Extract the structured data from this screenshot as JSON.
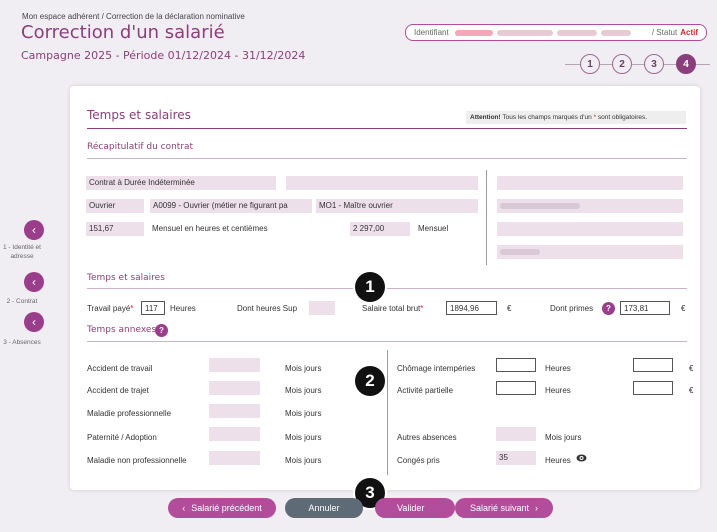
{
  "header": {
    "breadcrumb": "Mon espace adhérent / Correction de la déclaration nominative",
    "title": "Correction d'un salarié",
    "campaign": "Campagne 2025 - Période 01/12/2024 - 31/12/2024",
    "identifiant_label": "Identifiant",
    "status_label": "/ Statut",
    "status_value": "Actif"
  },
  "steps": [
    "1",
    "2",
    "3",
    "4"
  ],
  "active_step": 4,
  "sidebar": {
    "items": [
      {
        "label": "1 - Identité et adresse"
      },
      {
        "label": "2 - Contrat"
      },
      {
        "label": "3 - Absences"
      }
    ]
  },
  "section": {
    "title": "Temps et salaires",
    "attention_bold": "Attention!",
    "attention_text": " Tous les champs marqués d'un ",
    "attention_star": "*",
    "attention_end": " sont obligatoires."
  },
  "contract": {
    "title": "Récapitulatif du contrat",
    "type": "Contrat à Durée Indéterminée",
    "category": "Ouvrier",
    "job": "A0099 - Ouvrier (métier ne figurant pa",
    "level": "MO1 - Maître ouvrier",
    "hours": "151,67",
    "hours_label": "Mensuel en heures et centièmes",
    "salary": "2 297,00",
    "salary_label": "Mensuel"
  },
  "salaries": {
    "title": "Temps et salaires",
    "worked_label": "Travail payé",
    "worked_value": "117",
    "worked_unit": "Heures",
    "overtime_label": "Dont heures Sup",
    "gross_label": "Salaire total brut",
    "gross_value": "1894,96",
    "gross_unit": "€",
    "bonus_label": "Dont primes",
    "bonus_value": "173,81",
    "bonus_unit": "€",
    "star": "*"
  },
  "annex": {
    "title": "Temps annexes",
    "left_rows": [
      {
        "label": "Accident de travail",
        "unit": "Mois jours"
      },
      {
        "label": "Accident de trajet",
        "unit": "Mois jours"
      },
      {
        "label": "Maladie professionnelle",
        "unit": "Mois jours"
      },
      {
        "label": "Paternité / Adoption",
        "unit": "Mois jours"
      },
      {
        "label": "Maladie non professionnelle",
        "unit": "Mois jours"
      }
    ],
    "right_rows": [
      {
        "label": "Chômage intempéries",
        "unit": "Heures",
        "euro": "€"
      },
      {
        "label": "Activité partielle",
        "unit": "Heures",
        "euro": "€"
      },
      {
        "label": "Autres absences",
        "unit": "Mois jours"
      },
      {
        "label": "Congés pris",
        "value": "35",
        "unit": "Heures"
      }
    ]
  },
  "badges": [
    "1",
    "2",
    "3"
  ],
  "buttons": {
    "prev": "Salarié précédent",
    "cancel": "Annuler",
    "validate": "Valider",
    "next": "Salarié suivant"
  }
}
